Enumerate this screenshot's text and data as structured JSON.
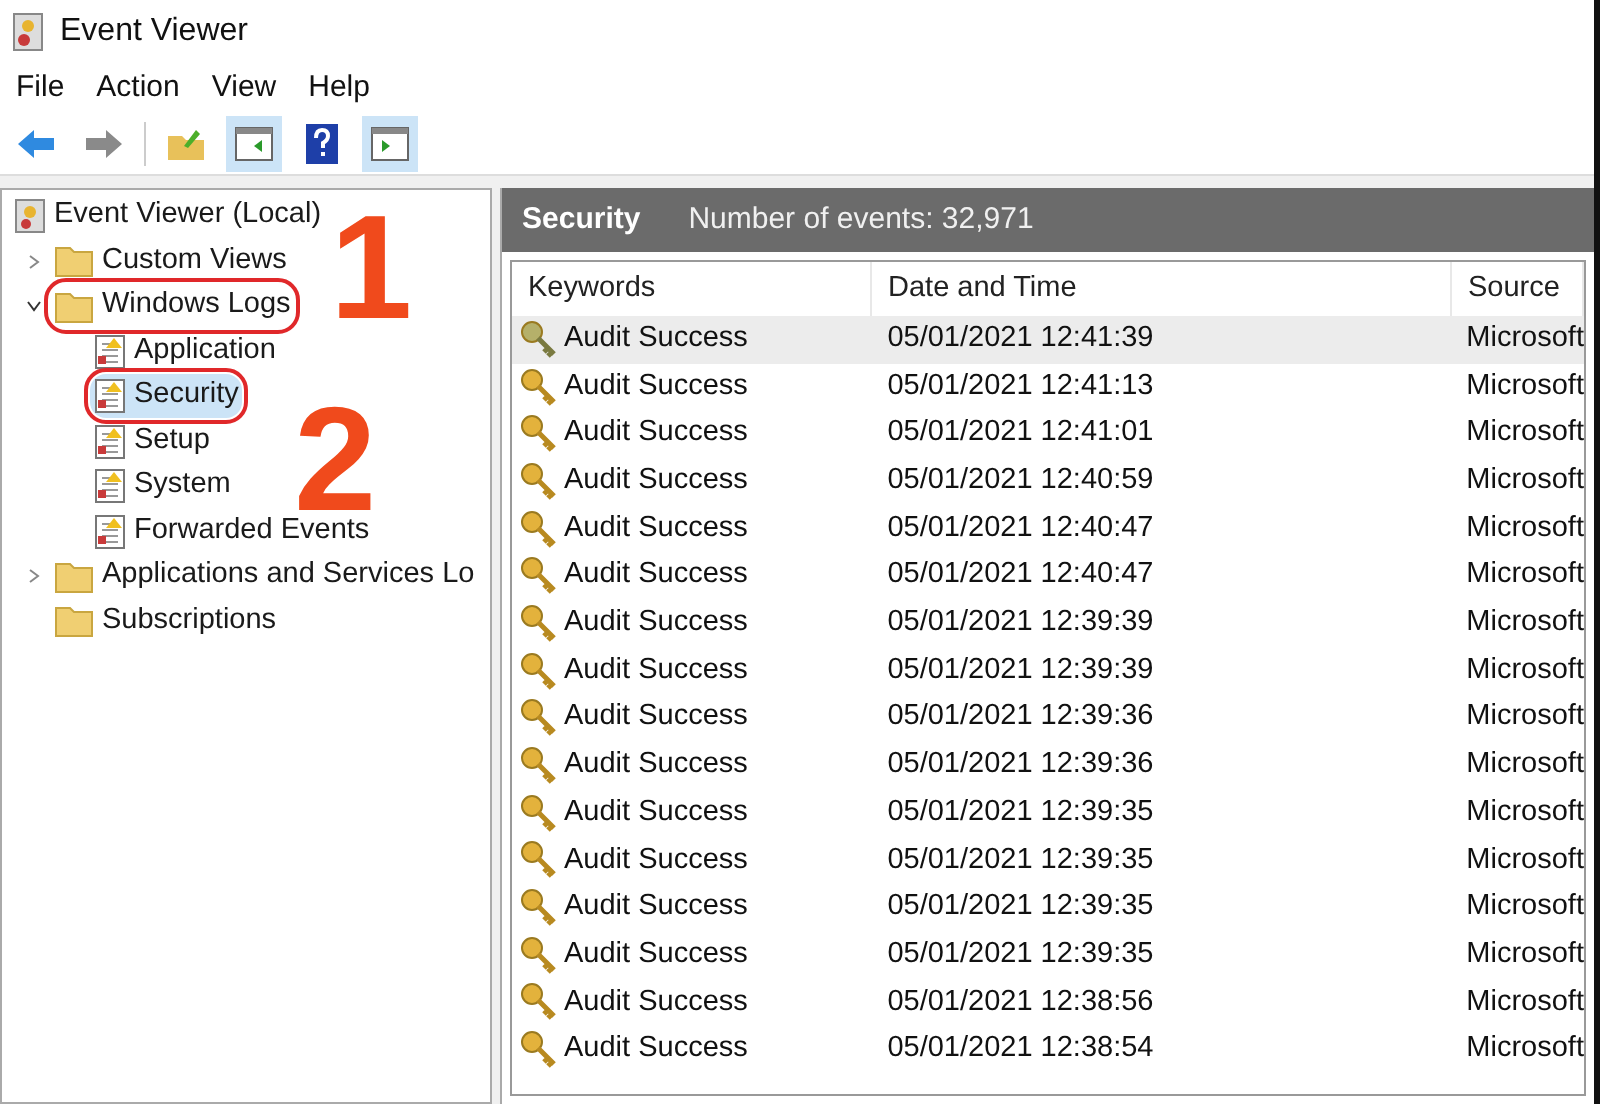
{
  "window": {
    "title": "Event Viewer"
  },
  "menu": [
    "File",
    "Action",
    "View",
    "Help"
  ],
  "toolbar": [
    {
      "kind": "back",
      "pressed": false
    },
    {
      "kind": "forward",
      "pressed": false
    },
    {
      "kind": "up",
      "pressed": false
    },
    {
      "kind": "tree",
      "pressed": true
    },
    {
      "kind": "help",
      "pressed": false
    },
    {
      "kind": "actions",
      "pressed": true
    }
  ],
  "tree": [
    {
      "label": "Event Viewer (Local)",
      "kind": "root",
      "selected": false,
      "circled": false,
      "children": [
        {
          "label": "Custom Views",
          "kind": "folder",
          "expanded": false,
          "selected": false,
          "circled": false
        },
        {
          "label": "Windows Logs",
          "kind": "folder",
          "expanded": true,
          "selected": false,
          "circled": true,
          "children": [
            {
              "label": "Application",
              "kind": "log",
              "selected": false,
              "circled": false
            },
            {
              "label": "Security",
              "kind": "log",
              "selected": true,
              "circled": true
            },
            {
              "label": "Setup",
              "kind": "log",
              "selected": false,
              "circled": false
            },
            {
              "label": "System",
              "kind": "log",
              "selected": false,
              "circled": false
            },
            {
              "label": "Forwarded Events",
              "kind": "log",
              "selected": false,
              "circled": false
            }
          ]
        },
        {
          "label": "Applications and Services Lo",
          "kind": "folder",
          "expanded": false,
          "selected": false,
          "circled": false
        },
        {
          "label": "Subscriptions",
          "kind": "folder",
          "selected": false,
          "circled": false
        }
      ]
    }
  ],
  "annotations": [
    "1",
    "2"
  ],
  "panel": {
    "title": "Security",
    "count": "Number of events: 32,971"
  },
  "table": {
    "columns": [
      "Keywords",
      "Date and Time",
      "Source"
    ],
    "rows": [
      {
        "cells": [
          "Audit Success",
          "05/01/2021 12:41:39",
          "Microsoft"
        ],
        "selected": true
      },
      {
        "cells": [
          "Audit Success",
          "05/01/2021 12:41:13",
          "Microsoft"
        ],
        "selected": false
      },
      {
        "cells": [
          "Audit Success",
          "05/01/2021 12:41:01",
          "Microsoft"
        ],
        "selected": false
      },
      {
        "cells": [
          "Audit Success",
          "05/01/2021 12:40:59",
          "Microsoft"
        ],
        "selected": false
      },
      {
        "cells": [
          "Audit Success",
          "05/01/2021 12:40:47",
          "Microsoft"
        ],
        "selected": false
      },
      {
        "cells": [
          "Audit Success",
          "05/01/2021 12:40:47",
          "Microsoft"
        ],
        "selected": false
      },
      {
        "cells": [
          "Audit Success",
          "05/01/2021 12:39:39",
          "Microsoft"
        ],
        "selected": false
      },
      {
        "cells": [
          "Audit Success",
          "05/01/2021 12:39:39",
          "Microsoft"
        ],
        "selected": false
      },
      {
        "cells": [
          "Audit Success",
          "05/01/2021 12:39:36",
          "Microsoft"
        ],
        "selected": false
      },
      {
        "cells": [
          "Audit Success",
          "05/01/2021 12:39:36",
          "Microsoft"
        ],
        "selected": false
      },
      {
        "cells": [
          "Audit Success",
          "05/01/2021 12:39:35",
          "Microsoft"
        ],
        "selected": false
      },
      {
        "cells": [
          "Audit Success",
          "05/01/2021 12:39:35",
          "Microsoft"
        ],
        "selected": false
      },
      {
        "cells": [
          "Audit Success",
          "05/01/2021 12:39:35",
          "Microsoft"
        ],
        "selected": false
      },
      {
        "cells": [
          "Audit Success",
          "05/01/2021 12:39:35",
          "Microsoft"
        ],
        "selected": false
      },
      {
        "cells": [
          "Audit Success",
          "05/01/2021 12:38:56",
          "Microsoft"
        ],
        "selected": false
      },
      {
        "cells": [
          "Audit Success",
          "05/01/2021 12:38:54",
          "Microsoft"
        ],
        "selected": false
      }
    ]
  }
}
